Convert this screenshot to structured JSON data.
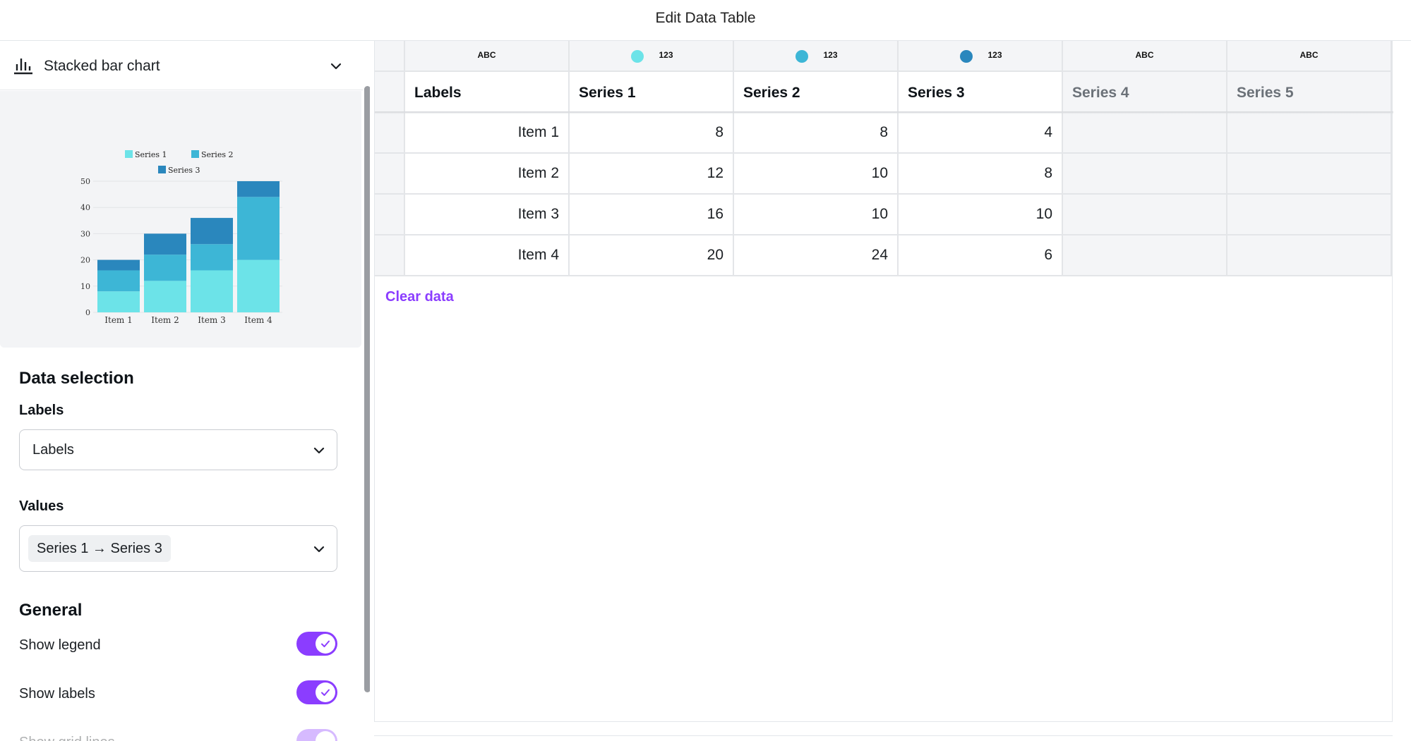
{
  "window": {
    "title": "Edit Data Table"
  },
  "chart_selector": {
    "label": "Stacked bar chart",
    "icon": "bar-chart-icon"
  },
  "chart_data": {
    "type": "bar",
    "stacked": true,
    "categories": [
      "Item 1",
      "Item 2",
      "Item 3",
      "Item 4"
    ],
    "series": [
      {
        "name": "Series 1",
        "values": [
          8,
          12,
          16,
          20
        ],
        "color": "#6ce3e8"
      },
      {
        "name": "Series 2",
        "values": [
          8,
          10,
          10,
          24
        ],
        "color": "#3db6d6"
      },
      {
        "name": "Series 3",
        "values": [
          4,
          8,
          10,
          6
        ],
        "color": "#2a87bd"
      }
    ],
    "y_ticks": [
      "0",
      "10",
      "20",
      "30",
      "40",
      "50"
    ],
    "ylim": [
      0,
      50
    ],
    "legend": "top",
    "grid": true
  },
  "data_selection": {
    "title": "Data selection",
    "labels_label": "Labels",
    "labels_value": "Labels",
    "values_label": "Values",
    "values_value": "Series 1 → Series 3"
  },
  "general": {
    "title": "General",
    "show_legend": "Show legend",
    "show_labels": "Show labels",
    "show_grid_lines": "Show grid lines",
    "legend_on": true,
    "labels_on": true,
    "grid_on": true
  },
  "table": {
    "type_row": [
      {
        "type": "ABC",
        "dot": ""
      },
      {
        "type": "123",
        "dot": "#6ce3e8"
      },
      {
        "type": "123",
        "dot": "#3db6d6"
      },
      {
        "type": "123",
        "dot": "#2a87bd"
      },
      {
        "type": "ABC",
        "dot": ""
      },
      {
        "type": "ABC",
        "dot": ""
      }
    ],
    "headers": [
      "Labels",
      "Series 1",
      "Series 2",
      "Series 3",
      "Series 4",
      "Series 5"
    ],
    "rows": [
      [
        "Item 1",
        "8",
        "8",
        "4",
        "",
        ""
      ],
      [
        "Item 2",
        "12",
        "10",
        "8",
        "",
        ""
      ],
      [
        "Item 3",
        "16",
        "10",
        "10",
        "",
        ""
      ],
      [
        "Item 4",
        "20",
        "24",
        "6",
        "",
        ""
      ]
    ]
  },
  "actions": {
    "clear_data": "Clear data"
  },
  "colors": {
    "accent": "#8b3dff"
  }
}
